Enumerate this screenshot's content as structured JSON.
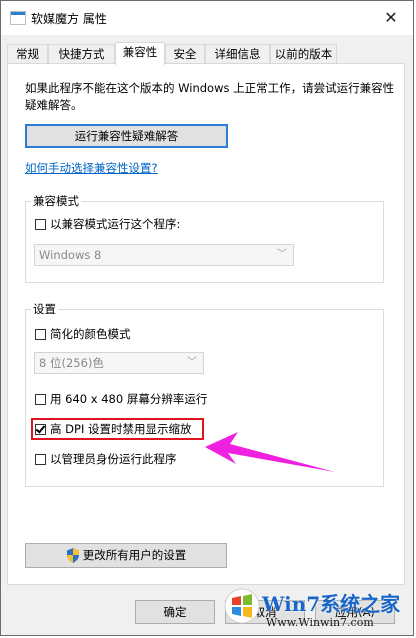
{
  "window": {
    "title": "软媒魔方 属性",
    "close_glyph": "✕"
  },
  "tabs": [
    {
      "label": "常规"
    },
    {
      "label": "快捷方式"
    },
    {
      "label": "兼容性"
    },
    {
      "label": "安全"
    },
    {
      "label": "详细信息"
    },
    {
      "label": "以前的版本"
    }
  ],
  "compat": {
    "intro_text": "如果此程序不能在这个版本的 Windows 上正常工作，请尝试运行兼容性疑难解答。",
    "troubleshoot_button": "运行兼容性疑难解答",
    "manual_link": "如何手动选择兼容性设置?",
    "mode_group": {
      "legend": "兼容模式",
      "checkbox_label": "以兼容模式运行这个程序:",
      "checked": false,
      "os_select_value": "Windows 8"
    },
    "settings_group": {
      "legend": "设置",
      "reduced_color": {
        "label": "简化的颜色模式",
        "checked": false
      },
      "color_select_value": "8 位(256)色",
      "run_640": {
        "label": "用 640 x 480 屏幕分辨率运行",
        "checked": false
      },
      "high_dpi": {
        "label": "高 DPI 设置时禁用显示缩放",
        "checked": true
      },
      "run_as_admin": {
        "label": "以管理员身份运行此程序",
        "checked": false
      }
    },
    "change_all_users_button": "更改所有用户的设置"
  },
  "footer": {
    "ok": "确定",
    "cancel": "取消",
    "apply": "应用(A)"
  },
  "watermark": {
    "brand": "Win7系统之家",
    "url": "Www.Winwin7.com"
  },
  "colors": {
    "accent_blue": "#2d7bd6",
    "highlight_red": "#e0141e",
    "arrow_magenta": "#f020e0",
    "link_blue": "#0064c8"
  }
}
